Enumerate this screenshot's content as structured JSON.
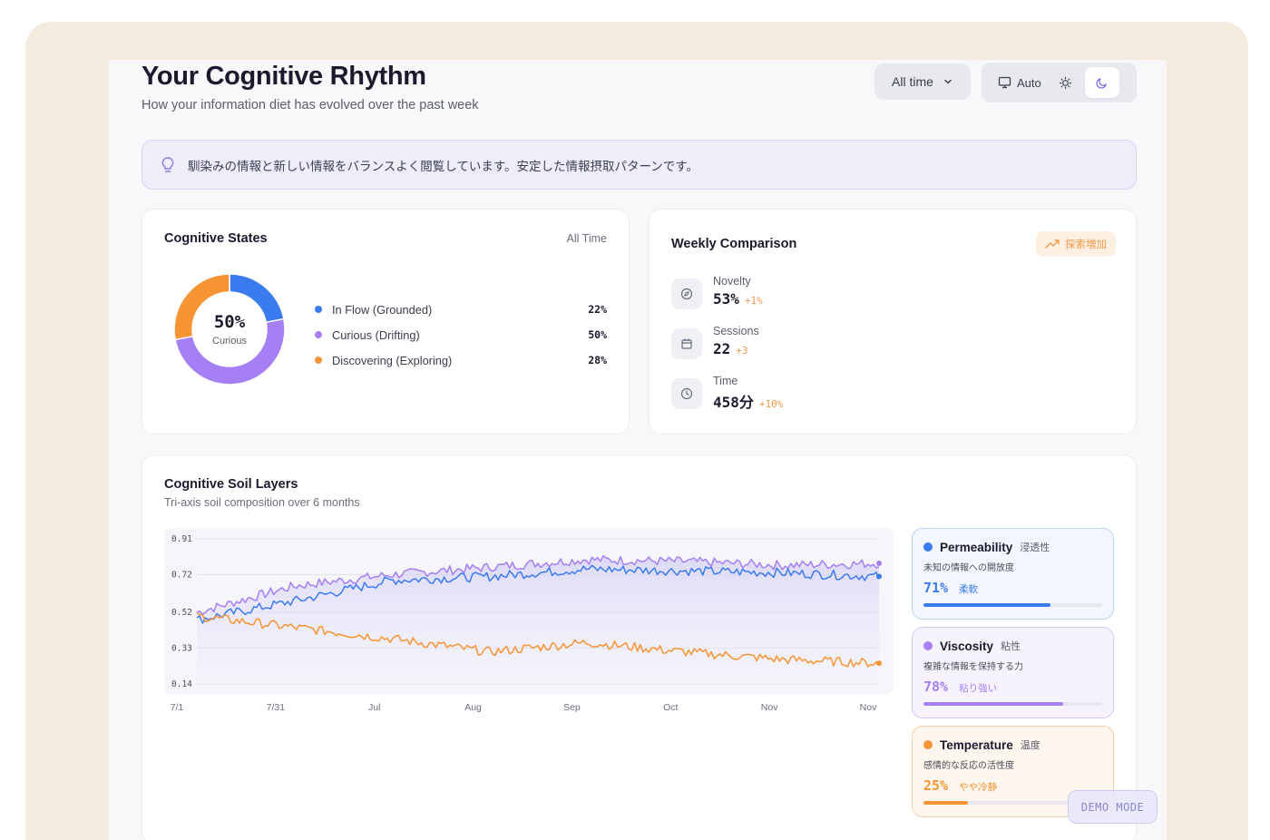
{
  "header": {
    "title": "Your Cognitive Rhythm",
    "subtitle": "How your information diet has evolved over the past week",
    "range_label": "All time",
    "theme_auto_label": "Auto"
  },
  "insight": {
    "icon": "lightbulb-icon",
    "text": "馴染みの情報と新しい情報をバランスよく閲覧しています。安定した情報摂取パターンです。"
  },
  "cognitive_states": {
    "title": "Cognitive States",
    "period": "All Time",
    "center_value": "50%",
    "center_label": "Curious",
    "items": [
      {
        "name": "In Flow (Grounded)",
        "pct": "22%",
        "value": 22,
        "color": "#3b7bf0"
      },
      {
        "name": "Curious (Drifting)",
        "pct": "50%",
        "value": 50,
        "color": "#a57ff3"
      },
      {
        "name": "Discovering (Exploring)",
        "pct": "28%",
        "value": 28,
        "color": "#f79433"
      }
    ]
  },
  "weekly": {
    "title": "Weekly Comparison",
    "badge": "探索増加",
    "metrics": [
      {
        "label": "Novelty",
        "value": "53%",
        "delta": "+1%",
        "icon": "compass-icon"
      },
      {
        "label": "Sessions",
        "value": "22",
        "delta": "+3",
        "icon": "calendar-icon"
      },
      {
        "label": "Time",
        "value": "458分",
        "delta": "+10%",
        "icon": "clock-icon"
      }
    ]
  },
  "soil": {
    "title": "Cognitive Soil Layers",
    "subtitle": "Tri-axis soil composition over 6 months",
    "axes": [
      {
        "name": "Permeability",
        "jp": "浸透性",
        "desc": "未知の情報への開放度",
        "value": "71%",
        "level": 0.71,
        "tag": "柔軟",
        "color": "#3b7bf0"
      },
      {
        "name": "Viscosity",
        "jp": "粘性",
        "desc": "複雑な情報を保持する力",
        "value": "78%",
        "level": 0.78,
        "tag": "粘り強い",
        "color": "#a57ff3"
      },
      {
        "name": "Temperature",
        "jp": "温度",
        "desc": "感情的な反応の活性度",
        "value": "25%",
        "level": 0.25,
        "tag": "やや冷静",
        "color": "#f79433"
      }
    ]
  },
  "chart_data": {
    "type": "line",
    "x": [
      "7/1",
      "7/31",
      "Jul",
      "Aug",
      "Sep",
      "Oct",
      "Nov",
      "Nov"
    ],
    "y_ticks": [
      0.91,
      0.72,
      0.52,
      0.33,
      0.14
    ],
    "ylim": [
      0.14,
      0.91
    ],
    "series": [
      {
        "name": "Viscosity",
        "color": "#a57ff3",
        "values": [
          0.52,
          0.66,
          0.72,
          0.76,
          0.8,
          0.79,
          0.77,
          0.78
        ]
      },
      {
        "name": "Permeability",
        "color": "#3b7bf0",
        "values": [
          0.48,
          0.58,
          0.69,
          0.71,
          0.75,
          0.74,
          0.73,
          0.71
        ]
      },
      {
        "name": "Temperature",
        "color": "#f79433",
        "values": [
          0.5,
          0.44,
          0.38,
          0.31,
          0.36,
          0.31,
          0.27,
          0.25
        ]
      }
    ]
  },
  "demo": {
    "label": "DEMO MODE"
  }
}
